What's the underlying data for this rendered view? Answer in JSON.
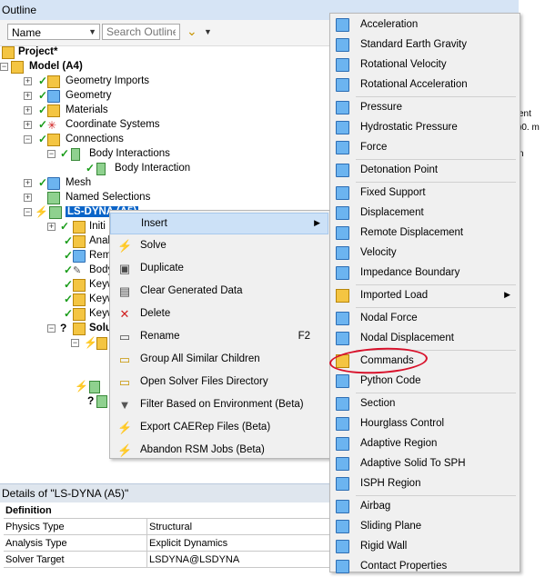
{
  "outline": {
    "title": "Outline",
    "name_select": "Name",
    "search_placeholder": "Search Outline"
  },
  "tree": {
    "project": "Project*",
    "model": "Model (A4)",
    "geometry_imports": "Geometry Imports",
    "geometry": "Geometry",
    "materials": "Materials",
    "coordinate_systems": "Coordinate Systems",
    "connections": "Connections",
    "body_interactions": "Body Interactions",
    "body_interaction": "Body Interaction",
    "mesh": "Mesh",
    "named_selections": "Named Selections",
    "lsdyna": "LS-DYNA (A5)",
    "partial": [
      "Initi",
      "Anal",
      "Rem",
      "Body",
      "Keyw",
      "Keyw",
      "Keyw",
      "Solu"
    ]
  },
  "context_menu": [
    {
      "label": "Insert",
      "shortcut": "",
      "icon": "none"
    },
    {
      "label": "Solve",
      "shortcut": "",
      "icon": "lightning-icon"
    },
    {
      "label": "Duplicate",
      "shortcut": "",
      "icon": "duplicate-icon"
    },
    {
      "label": "Clear Generated Data",
      "shortcut": "",
      "icon": "clear-icon"
    },
    {
      "label": "Delete",
      "shortcut": "",
      "icon": "delete-x-icon"
    },
    {
      "label": "Rename",
      "shortcut": "F2",
      "icon": "rename-icon"
    },
    {
      "label": "Group All Similar Children",
      "shortcut": "",
      "icon": "folder-icon"
    },
    {
      "label": "Open Solver Files Directory",
      "shortcut": "",
      "icon": "folder-icon"
    },
    {
      "label": "Filter Based on Environment (Beta)",
      "shortcut": "",
      "icon": "filter-icon"
    },
    {
      "label": "Export CAERep Files (Beta)",
      "shortcut": "",
      "icon": "lightning-icon"
    },
    {
      "label": "Abandon RSM Jobs (Beta)",
      "shortcut": "",
      "icon": "lightning-icon"
    }
  ],
  "submenu": [
    {
      "label": "Acceleration"
    },
    {
      "label": "Standard Earth Gravity"
    },
    {
      "label": "Rotational Velocity"
    },
    {
      "label": "Rotational Acceleration"
    },
    {
      "label": "Pressure"
    },
    {
      "label": "Hydrostatic Pressure"
    },
    {
      "label": "Force"
    },
    {
      "label": "Detonation Point"
    },
    {
      "label": "Fixed Support"
    },
    {
      "label": "Displacement"
    },
    {
      "label": "Remote Displacement"
    },
    {
      "label": "Velocity"
    },
    {
      "label": "Impedance Boundary"
    },
    {
      "label": "Imported Load"
    },
    {
      "label": "Nodal Force"
    },
    {
      "label": "Nodal Displacement"
    },
    {
      "label": "Commands"
    },
    {
      "label": "Python Code"
    },
    {
      "label": "Section"
    },
    {
      "label": "Hourglass Control"
    },
    {
      "label": "Adaptive Region"
    },
    {
      "label": "Adaptive Solid To SPH"
    },
    {
      "label": "ISPH Region"
    },
    {
      "label": "Airbag"
    },
    {
      "label": "Sliding Plane"
    },
    {
      "label": "Rigid Wall"
    },
    {
      "label": "Contact Properties"
    }
  ],
  "details": {
    "title": "Details of \"LS-DYNA (A5)\"",
    "section": "Definition",
    "rows": [
      {
        "key": "Physics Type",
        "value": "Structural"
      },
      {
        "key": "Analysis Type",
        "value": "Explicit Dynamics"
      },
      {
        "key": "Solver Target",
        "value": "LSDYNA@LSDYNA"
      }
    ]
  },
  "right_fragments": [
    "ent",
    ")0. m",
    "n"
  ]
}
